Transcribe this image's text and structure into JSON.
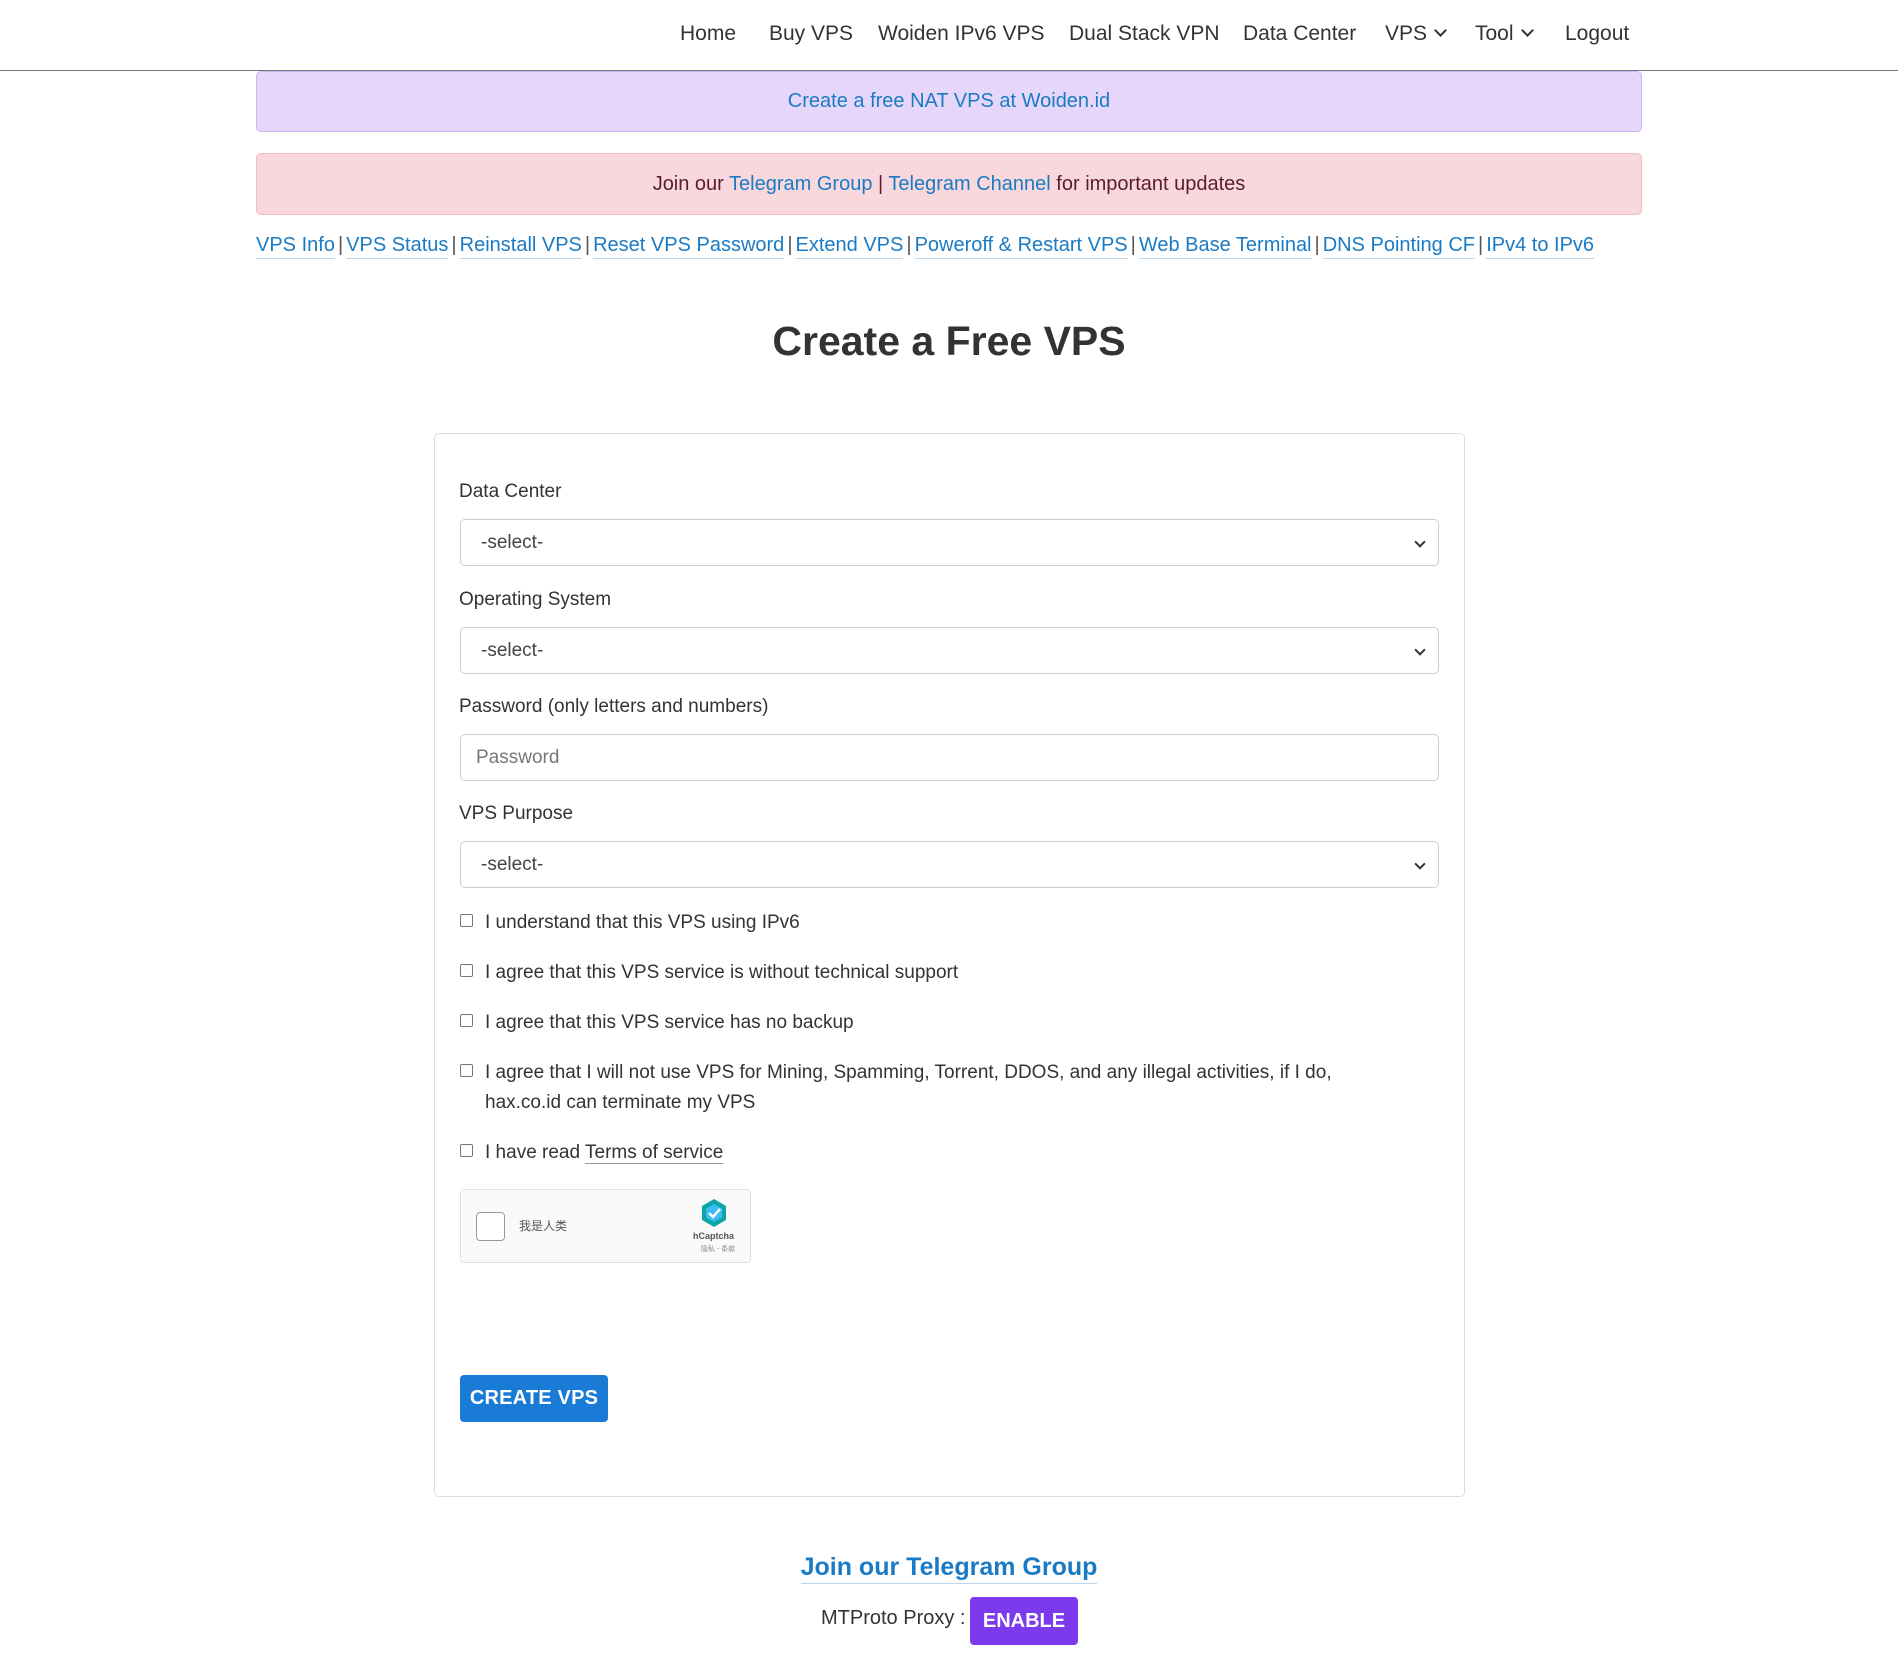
{
  "nav": {
    "items": [
      "Home",
      "Buy VPS",
      "Woiden IPv6 VPS",
      "Dual Stack VPN",
      "Data Center",
      "VPS",
      "Tool",
      "Logout"
    ]
  },
  "alerts": {
    "nat_link": "Create a free NAT VPS at Woiden.id",
    "tg_prefix": "Join our ",
    "tg_group": "Telegram Group",
    "tg_sep": " | ",
    "tg_channel": "Telegram Channel",
    "tg_suffix": " for important updates"
  },
  "quicklinks": [
    "VPS Info",
    "VPS Status",
    "Reinstall VPS",
    "Reset VPS Password",
    "Extend VPS",
    "Poweroff & Restart VPS",
    "Web Base Terminal",
    "DNS Pointing CF",
    "IPv4 to IPv6"
  ],
  "page": {
    "title": "Create a Free VPS"
  },
  "form": {
    "datacenter_label": "Data Center",
    "datacenter_value": "-select-",
    "os_label": "Operating System",
    "os_value": "-select-",
    "password_label": "Password (only letters and numbers)",
    "password_placeholder": "Password",
    "purpose_label": "VPS Purpose",
    "purpose_value": "-select-",
    "checks": [
      "I understand that this VPS using IPv6",
      "I agree that this VPS service is without technical support",
      "I agree that this VPS service has no backup",
      "I agree that I will not use VPS for Mining, Spamming, Torrent, DDOS, and any illegal activities, if I do, hax.co.id can terminate my VPS"
    ],
    "tos_prefix": "I have read ",
    "tos_link": "Terms of service",
    "captcha_label": "我是人类",
    "captcha_brand": "hCaptcha",
    "captcha_terms": "隐私 - 条款",
    "submit": "CREATE VPS"
  },
  "footer": {
    "tg_join": "Join our Telegram Group",
    "mtproto_label": "MTProto Proxy :",
    "enable": "ENABLE"
  },
  "colors": {
    "primary": "#1a7bd6",
    "link": "#1a7bc4",
    "enable": "#7c3aed",
    "alert_purple": "#e6d6fa",
    "alert_pink": "#f8d7dd"
  }
}
